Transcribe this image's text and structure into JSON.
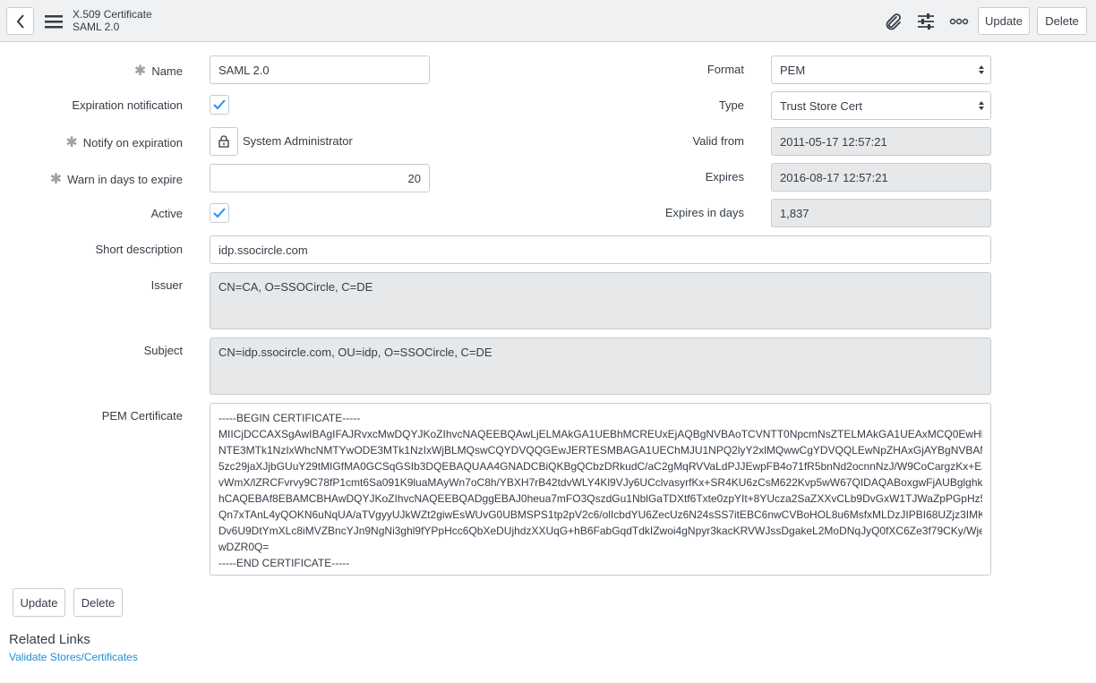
{
  "header": {
    "title": "X.509 Certificate",
    "subtitle": "SAML 2.0",
    "update_label": "Update",
    "delete_label": "Delete"
  },
  "form": {
    "name": {
      "label": "Name",
      "value": "SAML 2.0"
    },
    "expiration_notification": {
      "label": "Expiration notification",
      "checked": true
    },
    "notify_on_expiration": {
      "label": "Notify on expiration",
      "value": "System Administrator"
    },
    "warn_in_days": {
      "label": "Warn in days to expire",
      "value": "20"
    },
    "active": {
      "label": "Active",
      "checked": true
    },
    "format": {
      "label": "Format",
      "value": "PEM"
    },
    "type": {
      "label": "Type",
      "value": "Trust Store Cert"
    },
    "valid_from": {
      "label": "Valid from",
      "value": "2011-05-17 12:57:21"
    },
    "expires": {
      "label": "Expires",
      "value": "2016-08-17 12:57:21"
    },
    "expires_in_days": {
      "label": "Expires in days",
      "value": "1,837"
    },
    "short_description": {
      "label": "Short description",
      "value": "idp.ssocircle.com"
    },
    "issuer": {
      "label": "Issuer",
      "value": "CN=CA, O=SSOCircle, C=DE"
    },
    "subject": {
      "label": "Subject",
      "value": "CN=idp.ssocircle.com, OU=idp, O=SSOCircle, C=DE"
    },
    "pem_certificate": {
      "label": "PEM Certificate",
      "lines": [
        "-----BEGIN CERTIFICATE-----",
        "MIICjDCCAXSgAwIBAgIFAJRvxcMwDQYJKoZIhvcNAQEEBQAwLjELMAkGA1UEBhMCREUxEjAQBgNVBAoTCVNTT0NpcmNsZTELMAkGA1UEAxMCQ0EwHhcNMTEw",
        "NTE3MTk1NzIxWhcNMTYwODE3MTk1NzIxWjBLMQswCQYDVQQGEwJERTESMBAGA1UEChMJU1NPQ2lyY2xlMQwwCgYDVQQLEwNpZHAxGjAYBgNVBAMTEWlkcC",
        "5zc29jaXJjbGUuY29tMIGfMA0GCSqGSIb3DQEBAQUAA4GNADCBiQKBgQCbzDRkudC/aC2gMqRVVaLdPJJEwpFB4o71fR5bnNd2ocnnNzJ/W9CoCargzKx+EJ4Nm3",
        "vWmX/lZRCFvrvy9C78fP1cmt6Sa091K9luaMAyWn7oC8h/YBXH7rB42tdvWLY4Kl9VJy6UCclvasyrfKx+SR4KU6zCsM622Kvp5wW67QIDAQABoxgwFjAUBglghkgBhv",
        "hCAQEBAf8EBAMCBHAwDQYJKoZIhvcNAQEEBQADggEBAJ0heua7mFO3QszdGu1NblGaTDXtf6Txte0zpYIt+8YUcza2SaZXXvCLb9DvGxW1TJWaZpPGpHz5tLXJbdY",
        "Qn7xTAnL4yQOKN6uNqUA/aTVgyyUJkWZt2giwEsWUvG0UBMSPS1tp2pV2c6/olIcbdYU6ZecUz6N24sSS7itEBC6nwCVBoHOL8u6MsfxMLDzJIPBI68UZjz3IMKTDU",
        "Dv6U9DtYmXLc8iMVZBncYJn9NgNi3ghl9fYPpHcc6QbXeDUjhdzXXUqG+hB6FabGqdTdkIZwoi4gNpyr3kacKRVWJssDgakeL2MoDNqJyQ0fXC6Ze3f79CKy/WjeU5FL",
        "wDZR0Q=",
        "-----END CERTIFICATE-----"
      ]
    }
  },
  "footer": {
    "update_label": "Update",
    "delete_label": "Delete"
  },
  "related": {
    "title": "Related Links",
    "link": "Validate Stores/Certificates"
  }
}
